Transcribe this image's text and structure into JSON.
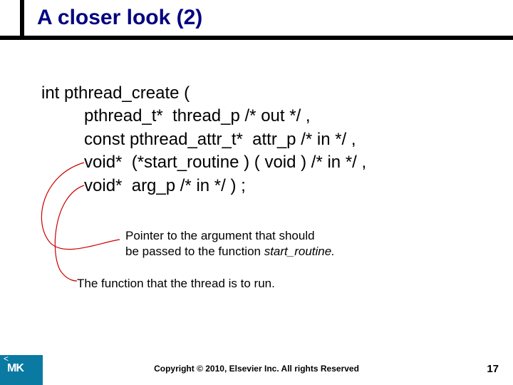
{
  "title": "A closer look (2)",
  "code": {
    "l1": "int pthread_create (",
    "l2": "         pthread_t*  thread_p /* out */ ,",
    "l3": "         const pthread_attr_t*  attr_p /* in */ ,",
    "l4": "         void*  (*start_routine ) ( void ) /* in */ ,",
    "l5": "         void*  arg_p /* in */ ) ;"
  },
  "annotation1_line1": "Pointer to the argument that should",
  "annotation1_line2_a": "be passed to the function ",
  "annotation1_line2_b": "start_routine.",
  "annotation2": "The function that the thread is to run.",
  "copyright": "Copyright © 2010, Elsevier Inc. All rights Reserved",
  "pagenum": "17",
  "logo_text": "MK"
}
